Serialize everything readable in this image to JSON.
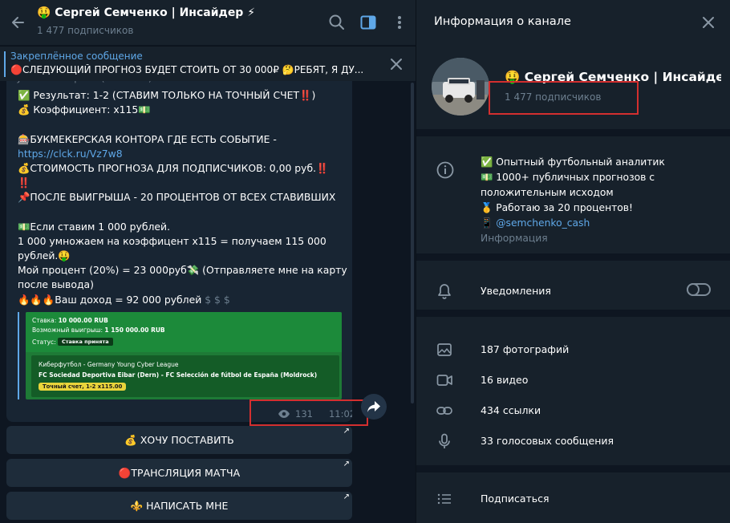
{
  "header": {
    "channel_title": "🤑 Сергей Семченко | Инсайдер ⚡",
    "subscribers": "1 477 подписчиков"
  },
  "pinned": {
    "title": "Закреплённое сообщение",
    "text": "🔴СЛЕДУЮЩИЙ ПРОГНОЗ БУДЕТ СТОИТЬ ОТ 30 000₽ 🤔РЕБЯТ, Я ДУ..."
  },
  "message": {
    "clipped_top": "Jaitocera Espana (Moldrock)",
    "l1a": "✅  Результат: 1-2 (СТАВИМ ТОЛЬКО НА ТОЧНЫЙ СЧЕТ",
    "l1b": "‼️",
    "l1c": ")",
    "l2": "💰 Коэффициент: x115💵",
    "l3": "🎰БУКМЕКЕРСКАЯ КОНТОРА ГДЕ ЕСТЬ СОБЫТИЕ -",
    "l4": "https://clck.ru/Vz7w8",
    "l5a": "💰СТОИМОСТЬ ПРОГНОЗА ДЛЯ ПОДПИСЧИКОВ: 0,00 руб.",
    "l5b": "‼️",
    "l6": "‼️",
    "l7": "📌ПОСЛЕ ВЫИГРЫША - 20 ПРОЦЕНТОВ ОТ ВСЕХ СТАВИВШИХ",
    "l8": "💵Если ставим 1 000 рублей.",
    "l9": "1 000 умножаем на коэффицент х115 = получаем 115 000",
    "l10": "рублей.🤑",
    "l11": "Мой процент (20%) = 23 000руб💸 (Отправляете мне на карту",
    "l12": "после вывода)",
    "l13a": "🔥🔥🔥Ваш доход = 92 000 рублей",
    "l13b": "$ $ $",
    "preview": {
      "stake_label": "Ставка: ",
      "stake_value": "10 000.00 RUB",
      "win_label": "Возможный выигрыш: ",
      "win_value": "1 150 000.00 RUB",
      "status_label": "Статус:",
      "status_value": "Ставка принята",
      "league": "Киберфутбол - Germany Young Cyber League",
      "match": "FC Sociedad Deportiva Eibar (Dern) - FC Selección de fútbol de España (Moldrock)",
      "score": "Точный счет, 1-2 x115.00"
    },
    "views": "131",
    "time": "11:02"
  },
  "buttons": {
    "b1": "💰 ХОЧУ ПОСТАВИТЬ",
    "b2": "🔴ТРАНСЛЯЦИЯ МАТЧА",
    "b3": "⚜️ НАПИСАТЬ МНЕ",
    "arrow": "↗"
  },
  "info_panel": {
    "title": "Информация о канале",
    "name": "🤑 Сергей Семченко | Инсайдер ⚡",
    "subscribers": "1 477 подписчиков",
    "desc1": "✅ Опытный футбольный аналитик",
    "desc2": "💵 1000+ публичных прогнозов с",
    "desc3": "положительным исходом",
    "desc4": "🥇 Работаю за 20 процентов!",
    "desc5_icon": "📱",
    "desc5_link": "@semchenko_cash",
    "desc_label": "Информация",
    "notifications": "Уведомления",
    "photos": "187 фотографий",
    "videos": "16 видео",
    "links": "434 ссылки",
    "voice": "33 голосовых сообщения",
    "subscribe": "Подписаться"
  },
  "colors": {
    "accent": "#5fa8e8",
    "highlight_box": "#d32f2f",
    "bet_green": "#1c8a3a"
  }
}
